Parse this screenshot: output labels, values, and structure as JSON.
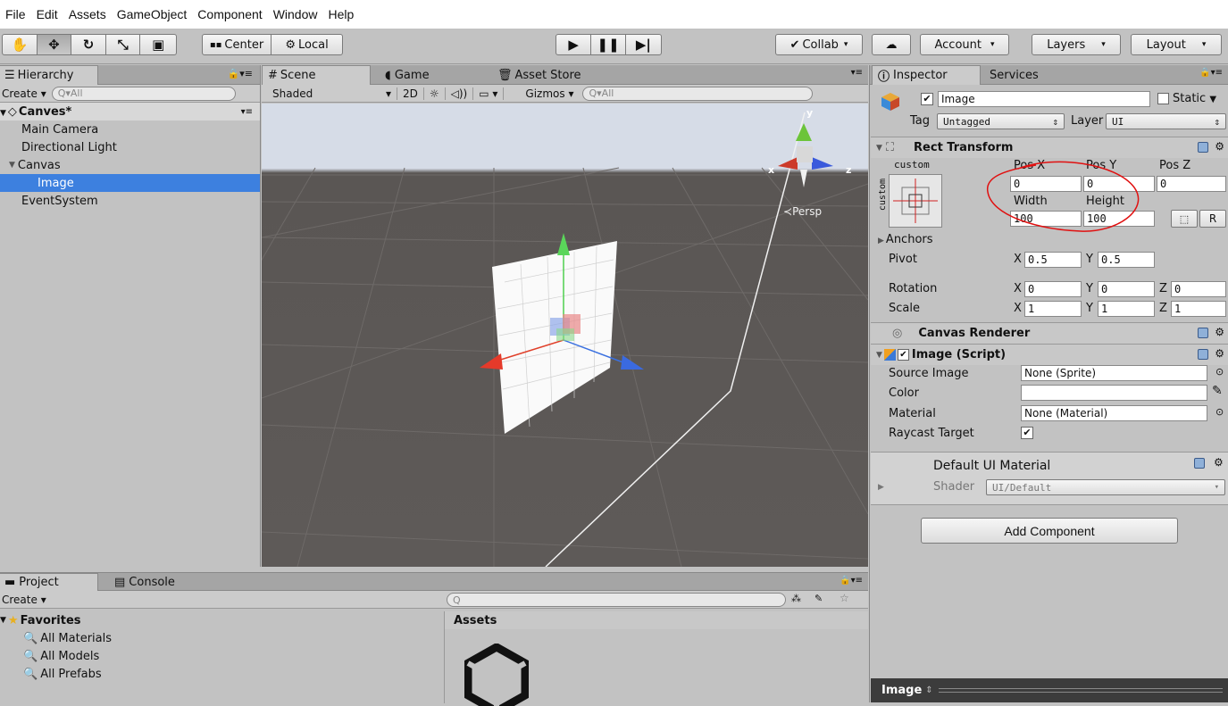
{
  "menu": [
    "File",
    "Edit",
    "Assets",
    "GameObject",
    "Component",
    "Window",
    "Help"
  ],
  "toolbar": {
    "pivot_center": "Center",
    "pivot_local": "Local",
    "collab": "Collab",
    "account": "Account",
    "layers": "Layers",
    "layout": "Layout"
  },
  "hierarchy": {
    "tab": "Hierarchy",
    "create": "Create",
    "search_placeholder": "Q▾All",
    "scene_name": "Canves*",
    "items": [
      "Main Camera",
      "Directional Light",
      "Canvas",
      "Image",
      "EventSystem"
    ]
  },
  "scene": {
    "tabs": [
      "Scene",
      "Game",
      "Asset Store"
    ],
    "shading": "Shaded",
    "mode_2d": "2D",
    "gizmos": "Gizmos",
    "search_placeholder": "Q▾All",
    "persp_label": "Persp",
    "axis_x": "x",
    "axis_y": "y",
    "axis_z": "z"
  },
  "inspector": {
    "tabs": [
      "Inspector",
      "Services"
    ],
    "object_name": "Image",
    "static_label": "Static",
    "tag_label": "Tag",
    "tag_value": "Untagged",
    "layer_label": "Layer",
    "layer_value": "UI",
    "rect_transform": {
      "title": "Rect Transform",
      "anchor_preset": "custom",
      "anchor_side": "custom",
      "posx_label": "Pos X",
      "posy_label": "Pos Y",
      "posz_label": "Pos Z",
      "posx": "0",
      "posy": "0",
      "posz": "0",
      "width_label": "Width",
      "height_label": "Height",
      "width": "100",
      "height": "100",
      "r_button": "R",
      "anchors": "Anchors",
      "pivot_label": "Pivot",
      "pivot_x": "0.5",
      "pivot_y": "0.5",
      "rotation_label": "Rotation",
      "rot_x": "0",
      "rot_y": "0",
      "rot_z": "0",
      "scale_label": "Scale",
      "scale_x": "1",
      "scale_y": "1",
      "scale_z": "1",
      "x": "X",
      "y": "Y",
      "z": "Z"
    },
    "canvas_renderer": "Canvas Renderer",
    "image_script": {
      "title": "Image (Script)",
      "source_image_label": "Source Image",
      "source_image": "None (Sprite)",
      "color_label": "Color",
      "material_label": "Material",
      "material": "None (Material)",
      "raycast_label": "Raycast Target"
    },
    "default_material": "Default UI Material",
    "shader_label": "Shader",
    "shader_value": "UI/Default",
    "add_component": "Add Component",
    "preview_title": "Image"
  },
  "project": {
    "tabs": [
      "Project",
      "Console"
    ],
    "create": "Create",
    "favorites": "Favorites",
    "favorite_items": [
      "All Materials",
      "All Models",
      "All Prefabs"
    ],
    "assets_header": "Assets"
  },
  "colors": {
    "selection": "#3d80df",
    "scene_sky": "#d7dde8",
    "scene_ground": "#5c5856",
    "annotation": "#e01010"
  }
}
